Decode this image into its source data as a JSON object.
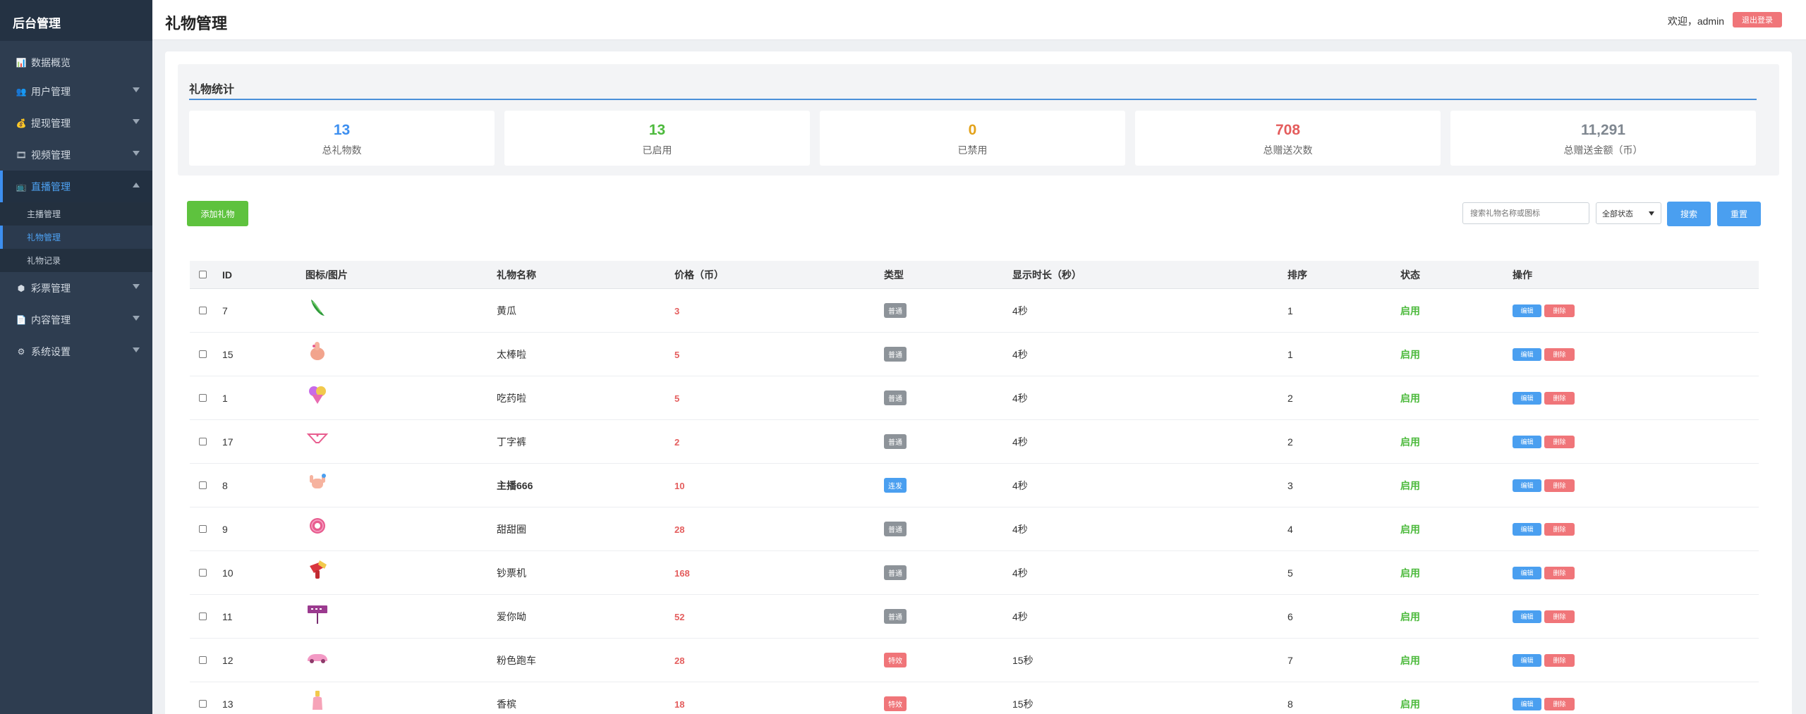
{
  "sidebar": {
    "brand": "后台管理",
    "menu": [
      {
        "label": "数据概览",
        "icon": "chart-icon",
        "glyph": "📊",
        "arrow": false
      },
      {
        "label": "用户管理",
        "icon": "users-icon",
        "glyph": "👥",
        "arrow": true
      },
      {
        "label": "提现管理",
        "icon": "money-bag-icon",
        "glyph": "💰",
        "arrow": true
      },
      {
        "label": "视频管理",
        "icon": "film-icon",
        "glyph": "🎞",
        "arrow": true
      },
      {
        "label": "直播管理",
        "icon": "tv-icon",
        "glyph": "📺",
        "arrow": true,
        "expanded": true
      }
    ],
    "submenu": [
      "主播管理",
      "礼物管理",
      "礼物记录"
    ],
    "menu_after": [
      {
        "label": "彩票管理",
        "icon": "cube-icon",
        "glyph": "⬢"
      },
      {
        "label": "内容管理",
        "icon": "document-icon",
        "glyph": "📄"
      },
      {
        "label": "系统设置",
        "icon": "gear-icon",
        "glyph": "⚙"
      }
    ]
  },
  "header": {
    "title": "礼物管理",
    "welcome": "欢迎，admin",
    "logout": "退出登录"
  },
  "stats": {
    "title": "礼物统计",
    "cards": [
      {
        "value": "13",
        "label": "总礼物数",
        "color": "#3d8ff0"
      },
      {
        "value": "13",
        "label": "已启用",
        "color": "#4dba3d"
      },
      {
        "value": "0",
        "label": "已禁用",
        "color": "#e3a21a"
      },
      {
        "value": "708",
        "label": "总赠送次数",
        "color": "#e45d5d"
      },
      {
        "value": "11,291",
        "label": "总赠送金额（币）",
        "color": "#7f8790"
      }
    ]
  },
  "toolbar": {
    "add_label": "添加礼物",
    "search_placeholder": "搜索礼物名称或图标",
    "status_selected": "全部状态",
    "search_label": "搜索",
    "reset_label": "重置"
  },
  "table": {
    "headers": [
      "ID",
      "图标/图片",
      "礼物名称",
      "价格（币）",
      "类型",
      "显示时长（秒）",
      "排序",
      "状态",
      "操作"
    ],
    "edit_label": "编辑",
    "delete_label": "删除",
    "type_colors": {
      "普通": "#8d9399",
      "连发": "#4a9ff0",
      "特效": "#f07579"
    },
    "rows": [
      {
        "id": "7",
        "icon": "cucumber-icon",
        "name": "黄瓜",
        "price": "3",
        "type": "普通",
        "duration": "4秒",
        "sort": "1",
        "status": "启用"
      },
      {
        "id": "15",
        "icon": "thumbs-up-icon",
        "name": "太棒啦",
        "price": "5",
        "type": "普通",
        "duration": "4秒",
        "sort": "1",
        "status": "启用"
      },
      {
        "id": "1",
        "icon": "pills-icon",
        "name": "吃药啦",
        "price": "5",
        "type": "普通",
        "duration": "4秒",
        "sort": "2",
        "status": "启用"
      },
      {
        "id": "17",
        "icon": "underwear-icon",
        "name": "丁字裤",
        "price": "2",
        "type": "普通",
        "duration": "4秒",
        "sort": "2",
        "status": "启用"
      },
      {
        "id": "8",
        "icon": "hand-666-icon",
        "name": "主播666",
        "price": "10",
        "type": "连发",
        "duration": "4秒",
        "sort": "3",
        "status": "启用"
      },
      {
        "id": "9",
        "icon": "donut-icon",
        "name": "甜甜圈",
        "price": "28",
        "type": "普通",
        "duration": "4秒",
        "sort": "4",
        "status": "启用"
      },
      {
        "id": "10",
        "icon": "money-gun-icon",
        "name": "钞票机",
        "price": "168",
        "type": "普通",
        "duration": "4秒",
        "sort": "5",
        "status": "启用"
      },
      {
        "id": "11",
        "icon": "love-sign-icon",
        "name": "爱你呦",
        "price": "52",
        "type": "普通",
        "duration": "4秒",
        "sort": "6",
        "status": "启用"
      },
      {
        "id": "12",
        "icon": "pink-car-icon",
        "name": "粉色跑车",
        "price": "28",
        "type": "特效",
        "duration": "15秒",
        "sort": "7",
        "status": "启用"
      },
      {
        "id": "13",
        "icon": "perfume-icon",
        "name": "香槟",
        "price": "18",
        "type": "特效",
        "duration": "15秒",
        "sort": "8",
        "status": "启用"
      }
    ]
  }
}
